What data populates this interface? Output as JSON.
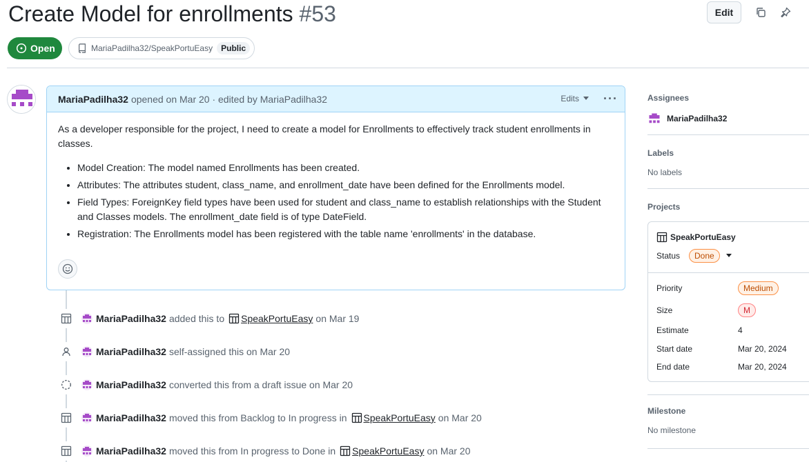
{
  "issue": {
    "title": "Create Model for enrollments",
    "number": "#53",
    "status": "Open",
    "repo": "MariaPadilha32/SpeakPortuEasy",
    "visibility": "Public",
    "edit_label": "Edit"
  },
  "comment": {
    "author": "MariaPadilha32",
    "meta": "opened on Mar 20 · edited by MariaPadilha32",
    "edits_label": "Edits",
    "intro": "As a developer responsible for the project, I need to create a model for Enrollments to effectively track student enrollments in classes.",
    "bullets": [
      "Model Creation: The model named Enrollments has been created.",
      "Attributes: The attributes student, class_name, and enrollment_date have been defined for the Enrollments model.",
      "Field Types: ForeignKey field types have been used for student and class_name to establish relationships with the Student and Classes models. The enrollment_date field is of type DateField.",
      "Registration: The Enrollments model has been registered with the table name 'enrollments' in the database."
    ]
  },
  "timeline": [
    {
      "icon": "table-icon",
      "user": "MariaPadilha32",
      "pre": "added this to",
      "link": "SpeakPortuEasy",
      "post": "on Mar 19"
    },
    {
      "icon": "person-icon",
      "user": "MariaPadilha32",
      "pre": "self-assigned this on Mar 20",
      "link": "",
      "post": ""
    },
    {
      "icon": "draft-circle-icon",
      "user": "MariaPadilha32",
      "pre": "converted this from a draft issue on Mar 20",
      "link": "",
      "post": ""
    },
    {
      "icon": "table-icon",
      "user": "MariaPadilha32",
      "pre": "moved this from Backlog to In progress in",
      "link": "SpeakPortuEasy",
      "post": "on Mar 20"
    },
    {
      "icon": "table-icon",
      "user": "MariaPadilha32",
      "pre": "moved this from In progress to Done in",
      "link": "SpeakPortuEasy",
      "post": "on Mar 20"
    }
  ],
  "sidebar": {
    "assignees_label": "Assignees",
    "assignee": "MariaPadilha32",
    "labels_label": "Labels",
    "labels_value": "No labels",
    "projects_label": "Projects",
    "project": {
      "name": "SpeakPortuEasy",
      "status_label": "Status",
      "status_value": "Done",
      "fields": [
        {
          "label": "Priority",
          "value": "Medium"
        },
        {
          "label": "Size",
          "value": "M"
        },
        {
          "label": "Estimate",
          "value": "4"
        },
        {
          "label": "Start date",
          "value": "Mar 20, 2024"
        },
        {
          "label": "End date",
          "value": "Mar 20, 2024"
        }
      ]
    },
    "milestone_label": "Milestone",
    "milestone_value": "No milestone"
  },
  "colors": {
    "open_green": "#1f883d",
    "comment_header_bg": "#ddf4ff",
    "avatar_purple": "#a64bc8"
  }
}
